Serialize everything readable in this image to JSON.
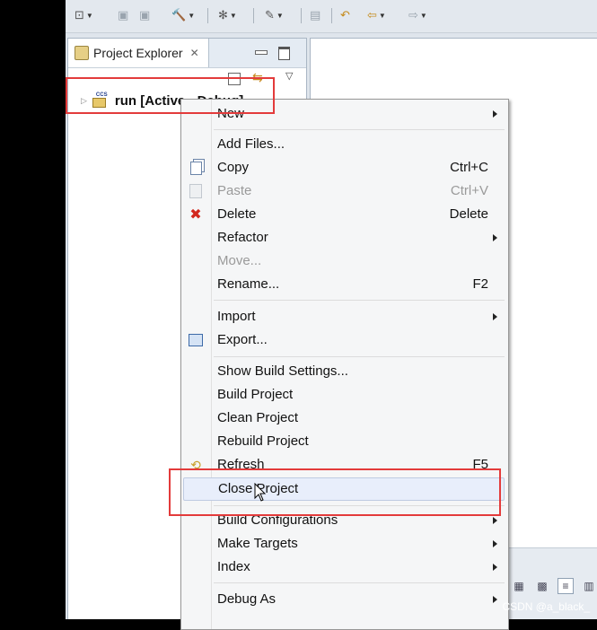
{
  "project_explorer": {
    "tab_label": "Project Explorer",
    "tree": [
      {
        "label": "run  [Active - Debug]"
      }
    ]
  },
  "context_menu": {
    "items": [
      {
        "label": "New",
        "submenu": true
      },
      {
        "label": "Add Files..."
      },
      {
        "label": "Copy",
        "shortcut": "Ctrl+C",
        "icon": "copy-icon"
      },
      {
        "label": "Paste",
        "shortcut": "Ctrl+V",
        "icon": "paste-icon",
        "disabled": true
      },
      {
        "label": "Delete",
        "shortcut": "Delete",
        "icon": "delete-icon"
      },
      {
        "label": "Refactor",
        "submenu": true
      },
      {
        "label": "Move...",
        "disabled": true
      },
      {
        "label": "Rename...",
        "shortcut": "F2"
      },
      {
        "label": "Import",
        "submenu": true
      },
      {
        "label": "Export...",
        "icon": "export-icon"
      },
      {
        "label": "Show Build Settings..."
      },
      {
        "label": "Build Project"
      },
      {
        "label": "Clean Project"
      },
      {
        "label": "Rebuild Project"
      },
      {
        "label": "Refresh",
        "shortcut": "F5",
        "icon": "refresh-icon"
      },
      {
        "label": "Close Project",
        "hovered": true
      },
      {
        "label": "Build Configurations",
        "submenu": true
      },
      {
        "label": "Make Targets",
        "submenu": true
      },
      {
        "label": "Index",
        "submenu": true
      },
      {
        "label": "Debug As",
        "submenu": true
      }
    ]
  },
  "annotation_color": "#e33b3b",
  "watermark": "CSDN @a_black_"
}
